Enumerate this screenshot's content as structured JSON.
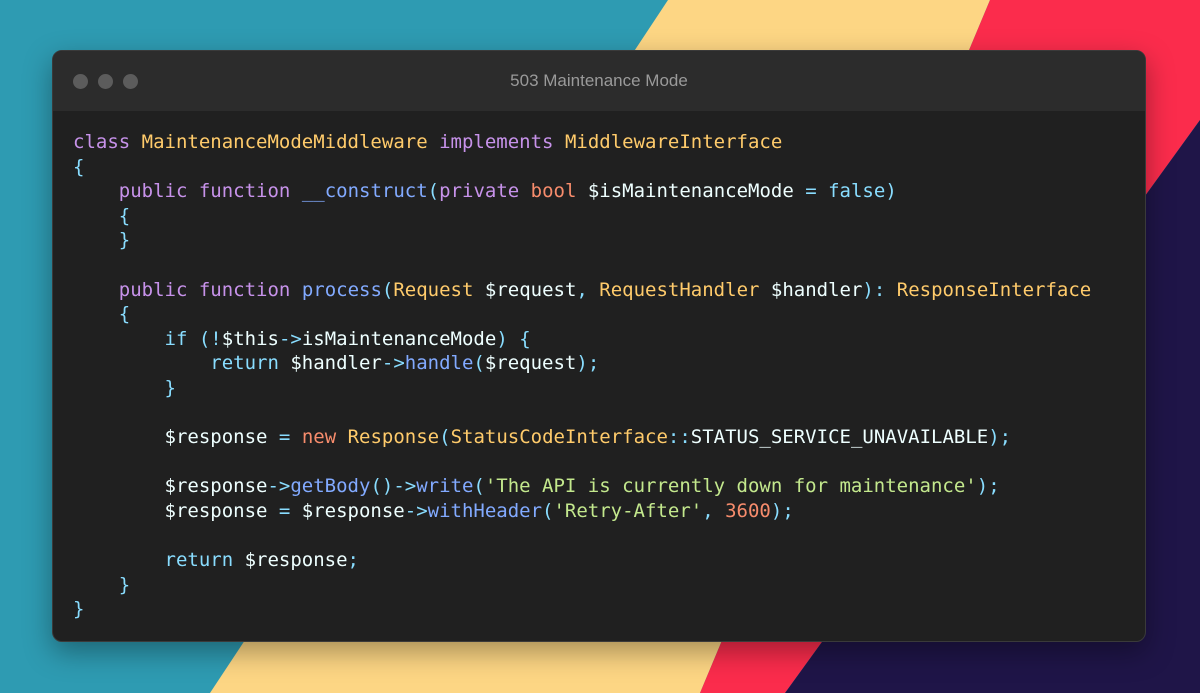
{
  "window": {
    "title": "503 Maintenance Mode"
  },
  "background": {
    "colors": [
      "#2e9bb2",
      "#fdd684",
      "#fb2c4c",
      "#1f1548"
    ]
  },
  "code_lines": [
    [
      [
        "kw",
        "class"
      ],
      [
        "var",
        " "
      ],
      [
        "cls",
        "MaintenanceModeMiddleware"
      ],
      [
        "var",
        " "
      ],
      [
        "kw",
        "implements"
      ],
      [
        "var",
        " "
      ],
      [
        "cls",
        "MiddlewareInterface"
      ]
    ],
    [
      [
        "punc",
        "{"
      ]
    ],
    [
      [
        "var",
        "    "
      ],
      [
        "kw",
        "public"
      ],
      [
        "var",
        " "
      ],
      [
        "kw",
        "function"
      ],
      [
        "var",
        " "
      ],
      [
        "fn",
        "__construct"
      ],
      [
        "punc",
        "("
      ],
      [
        "kw",
        "private"
      ],
      [
        "var",
        " "
      ],
      [
        "type",
        "bool"
      ],
      [
        "var",
        " $isMaintenanceMode "
      ],
      [
        "punc",
        "="
      ],
      [
        "var",
        " "
      ],
      [
        "bool",
        "false"
      ],
      [
        "punc",
        ")"
      ]
    ],
    [
      [
        "var",
        "    "
      ],
      [
        "punc",
        "{"
      ]
    ],
    [
      [
        "var",
        "    "
      ],
      [
        "punc",
        "}"
      ]
    ],
    [],
    [
      [
        "var",
        "    "
      ],
      [
        "kw",
        "public"
      ],
      [
        "var",
        " "
      ],
      [
        "kw",
        "function"
      ],
      [
        "var",
        " "
      ],
      [
        "fn",
        "process"
      ],
      [
        "punc",
        "("
      ],
      [
        "cls",
        "Request"
      ],
      [
        "var",
        " $request"
      ],
      [
        "punc",
        ","
      ],
      [
        "var",
        " "
      ],
      [
        "cls",
        "RequestHandler"
      ],
      [
        "var",
        " $handler"
      ],
      [
        "punc",
        "):"
      ],
      [
        "var",
        " "
      ],
      [
        "cls",
        "ResponseInterface"
      ]
    ],
    [
      [
        "var",
        "    "
      ],
      [
        "punc",
        "{"
      ]
    ],
    [
      [
        "var",
        "        "
      ],
      [
        "kw2",
        "if"
      ],
      [
        "var",
        " "
      ],
      [
        "punc",
        "(!"
      ],
      [
        "var",
        "$this"
      ],
      [
        "punc",
        "->"
      ],
      [
        "var",
        "isMaintenanceMode"
      ],
      [
        "punc",
        ")"
      ],
      [
        "var",
        " "
      ],
      [
        "punc",
        "{"
      ]
    ],
    [
      [
        "var",
        "            "
      ],
      [
        "kw2",
        "return"
      ],
      [
        "var",
        " $handler"
      ],
      [
        "punc",
        "->"
      ],
      [
        "fn",
        "handle"
      ],
      [
        "punc",
        "("
      ],
      [
        "var",
        "$request"
      ],
      [
        "punc",
        ");"
      ]
    ],
    [
      [
        "var",
        "        "
      ],
      [
        "punc",
        "}"
      ]
    ],
    [],
    [
      [
        "var",
        "        $response "
      ],
      [
        "punc",
        "="
      ],
      [
        "var",
        " "
      ],
      [
        "new",
        "new"
      ],
      [
        "var",
        " "
      ],
      [
        "cls",
        "Response"
      ],
      [
        "punc",
        "("
      ],
      [
        "cls",
        "StatusCodeInterface"
      ],
      [
        "punc",
        "::"
      ],
      [
        "const",
        "STATUS_SERVICE_UNAVAILABLE"
      ],
      [
        "punc",
        ");"
      ]
    ],
    [],
    [
      [
        "var",
        "        $response"
      ],
      [
        "punc",
        "->"
      ],
      [
        "fn",
        "getBody"
      ],
      [
        "punc",
        "()->"
      ],
      [
        "fn",
        "write"
      ],
      [
        "punc",
        "("
      ],
      [
        "str",
        "'The API is currently down for maintenance'"
      ],
      [
        "punc",
        ");"
      ]
    ],
    [
      [
        "var",
        "        $response "
      ],
      [
        "punc",
        "="
      ],
      [
        "var",
        " $response"
      ],
      [
        "punc",
        "->"
      ],
      [
        "fn",
        "withHeader"
      ],
      [
        "punc",
        "("
      ],
      [
        "str",
        "'Retry-After'"
      ],
      [
        "punc",
        ","
      ],
      [
        "var",
        " "
      ],
      [
        "num",
        "3600"
      ],
      [
        "punc",
        ");"
      ]
    ],
    [],
    [
      [
        "var",
        "        "
      ],
      [
        "kw2",
        "return"
      ],
      [
        "var",
        " $response"
      ],
      [
        "punc",
        ";"
      ]
    ],
    [
      [
        "var",
        "    "
      ],
      [
        "punc",
        "}"
      ]
    ],
    [
      [
        "punc",
        "}"
      ]
    ]
  ]
}
